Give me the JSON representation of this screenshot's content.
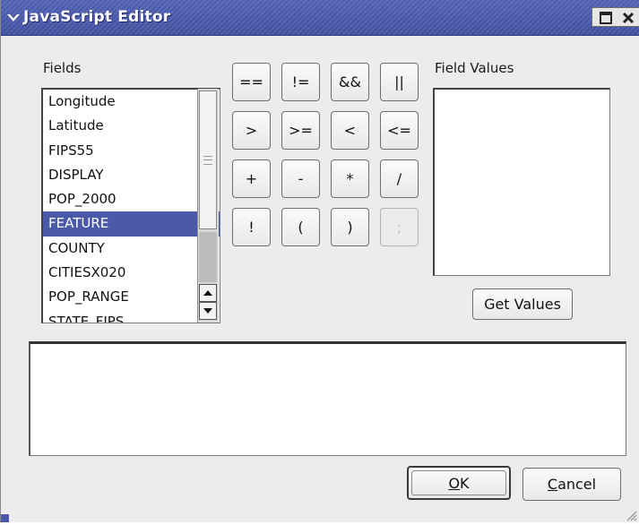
{
  "window": {
    "title": "JavaScript Editor",
    "accent_color": "#4b5aa8",
    "icons": [
      "chevron-down-icon",
      "maximize-icon",
      "close-icon",
      "resize-grip-icon"
    ]
  },
  "fields": {
    "label": "Fields",
    "items": [
      "Longitude",
      "Latitude",
      "FIPS55",
      "DISPLAY",
      "POP_2000",
      "FEATURE",
      "COUNTY",
      "CITIESX020",
      "POP_RANGE",
      "STATE_FIPS"
    ],
    "selected": "FEATURE"
  },
  "operators": {
    "row1": [
      "==",
      "!=",
      "&&",
      "||"
    ],
    "row2": [
      ">",
      ">=",
      "<",
      "<="
    ],
    "row3": [
      "+",
      "-",
      "*",
      "/"
    ],
    "row4": [
      "!",
      "(",
      ")",
      ";"
    ]
  },
  "field_values": {
    "label": "Field Values",
    "get_values_label": "Get Values"
  },
  "expression": {
    "value": ""
  },
  "buttons": {
    "ok_label": "OK",
    "cancel_label": "Cancel"
  }
}
